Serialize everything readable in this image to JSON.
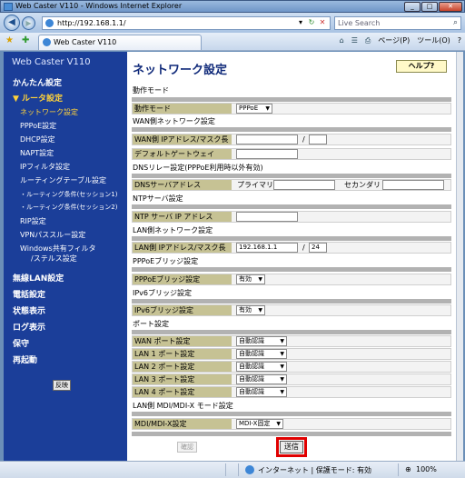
{
  "window": {
    "title": "Web Caster V110 - Windows Internet Explorer",
    "minimize": "_",
    "maximize": "□",
    "close": "✕"
  },
  "address": {
    "url": "http://192.168.1.1/",
    "search_placeholder": "Live Search"
  },
  "tab": {
    "label": "Web Caster V110"
  },
  "commands": {
    "page": "ページ(P)",
    "tools": "ツール(O)",
    "help": "?"
  },
  "sidebar": {
    "brand": "Web Caster V110",
    "easy": "かんたん設定",
    "router": "▼ ルータ設定",
    "items": [
      "ネットワーク設定",
      "PPPoE設定",
      "DHCP設定",
      "NAPT設定",
      "IPフィルタ設定",
      "ルーティングテーブル設定"
    ],
    "sub_items": [
      "・ルーティング条件(セッション1)",
      "・ルーティング条件(セッション2)"
    ],
    "items2": [
      "RIP設定",
      "VPNパススルー設定"
    ],
    "windows_filter_1": "Windows共有フィルタ",
    "windows_filter_2": "/ステルス設定",
    "majors": [
      "無線LAN設定",
      "電話設定",
      "状態表示",
      "ログ表示",
      "保守",
      "再起動"
    ],
    "reflect": "反映"
  },
  "content": {
    "title": "ネットワーク設定",
    "help": "ヘルプ?",
    "sections": {
      "mode": "動作モード",
      "wan": "WAN側ネットワーク設定",
      "dns": "DNSリレー設定(PPPoE利用時以外有効)",
      "ntp": "NTPサーバ設定",
      "lan": "LAN側ネットワーク設定",
      "pppoe_bridge": "PPPoEブリッジ設定",
      "ipv6_bridge": "IPv6ブリッジ設定",
      "port": "ポート設定",
      "mdi": "LAN側 MDI/MDI-X モード設定"
    },
    "fields": {
      "mode_label": "動作モード",
      "mode_value": "PPPoE",
      "wan_ip_label": "WAN側 IPアドレス/マスク長",
      "gateway_label": "デフォルトゲートウェイ",
      "dns_label": "DNSサーバアドレス",
      "dns_primary": "プライマリ",
      "dns_secondary": "セカンダリ",
      "ntp_label": "NTP サーバ IP アドレス",
      "lan_ip_label": "LAN側 IPアドレス/マスク長",
      "lan_ip_value": "192.168.1.1",
      "lan_mask_value": "24",
      "pppoe_bridge_label": "PPPoEブリッジ設定",
      "pppoe_bridge_value": "有効",
      "ipv6_bridge_label": "IPv6ブリッジ設定",
      "ipv6_bridge_value": "有効",
      "ports": [
        {
          "label": "WAN ポート設定",
          "value": "自動認識"
        },
        {
          "label": "LAN 1 ポート設定",
          "value": "自動認識"
        },
        {
          "label": "LAN 2 ポート設定",
          "value": "自動認識"
        },
        {
          "label": "LAN 3 ポート設定",
          "value": "自動認識"
        },
        {
          "label": "LAN 4 ポート設定",
          "value": "自動認識"
        }
      ],
      "mdi_label": "MDI/MDI-X設定",
      "mdi_value": "MDI-X固定",
      "slash": "/"
    },
    "confirm": "確認",
    "send": "送信"
  },
  "status": {
    "zone": "インターネット | 保護モード: 有効",
    "zoom": "100%"
  }
}
